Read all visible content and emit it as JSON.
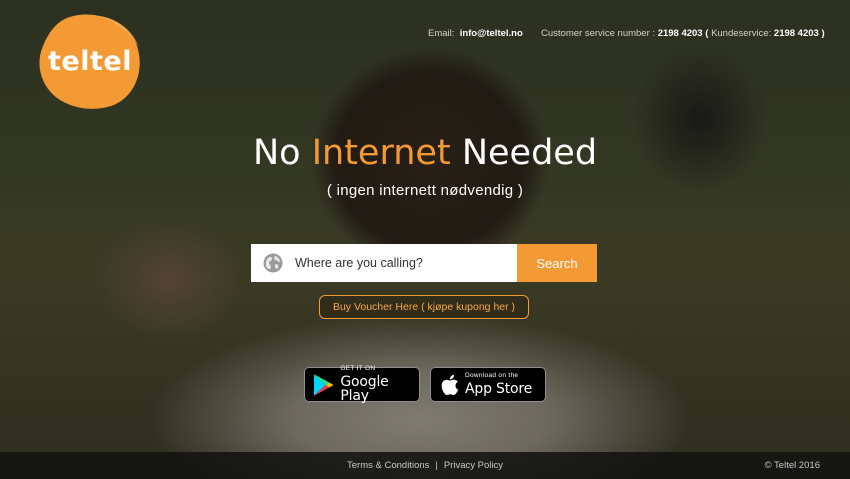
{
  "brand": {
    "name": "teltel",
    "color": "#f39a35"
  },
  "contact": {
    "email_label": "Email:",
    "email_value": "info@teltel.no",
    "phone_label": "Customer service number :",
    "phone_value": "2198 4203",
    "phone_paren_open": "(",
    "kundeservice_label": "Kundeservice:",
    "kundeservice_value": "2198 4203",
    "phone_paren_close": ")"
  },
  "hero": {
    "headline_prefix": "No",
    "headline_accent": "Internet",
    "headline_suffix": "Needed",
    "subheadline": "( ingen internett nødvendig  )"
  },
  "search": {
    "placeholder": "Where are you calling?",
    "value": "",
    "button_label": "Search",
    "icon": "globe-icon"
  },
  "voucher": {
    "label": "Buy Voucher Here ( kjøpe kupong her )"
  },
  "stores": {
    "google": {
      "small": "GET IT ON",
      "big": "Google Play",
      "icon": "google-play-icon"
    },
    "apple": {
      "small": "Download on the",
      "big": "App Store",
      "icon": "apple-icon"
    }
  },
  "footer": {
    "terms": "Terms & Conditions",
    "separator": "|",
    "privacy": "Privacy Policy",
    "copyright": "© Teltel 2016"
  }
}
